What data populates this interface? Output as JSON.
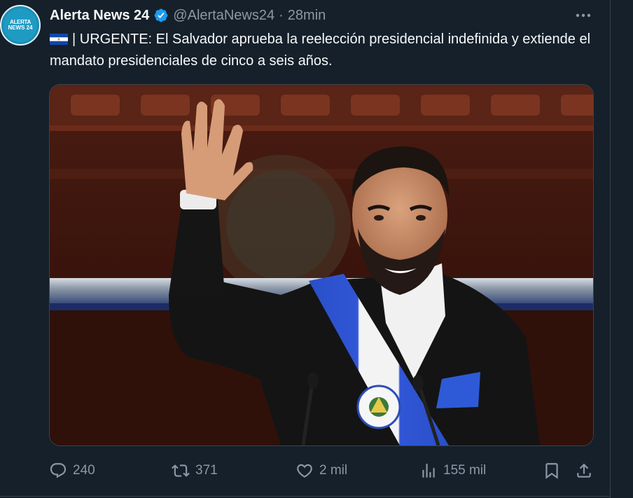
{
  "author": {
    "avatar_text_line1": "ALERTA",
    "avatar_text_line2": "NEWS 24",
    "name": "Alerta News 24",
    "handle": "@AlertaNews24",
    "separator": "·",
    "time": "28min"
  },
  "tweet": {
    "text": "| URGENTE: El Salvador aprueba la reelección presidencial indefinida y extiende el mandato presidenciales de cinco a seis años.",
    "flag_icon": "el-salvador-flag"
  },
  "actions": {
    "replies": "240",
    "retweets": "371",
    "likes": "2 mil",
    "views": "155 mil"
  },
  "colors": {
    "background": "#15202b",
    "text": "#f7f9f9",
    "muted": "#8b98a5",
    "verified": "#1d9bf0",
    "divider": "#38444d"
  }
}
